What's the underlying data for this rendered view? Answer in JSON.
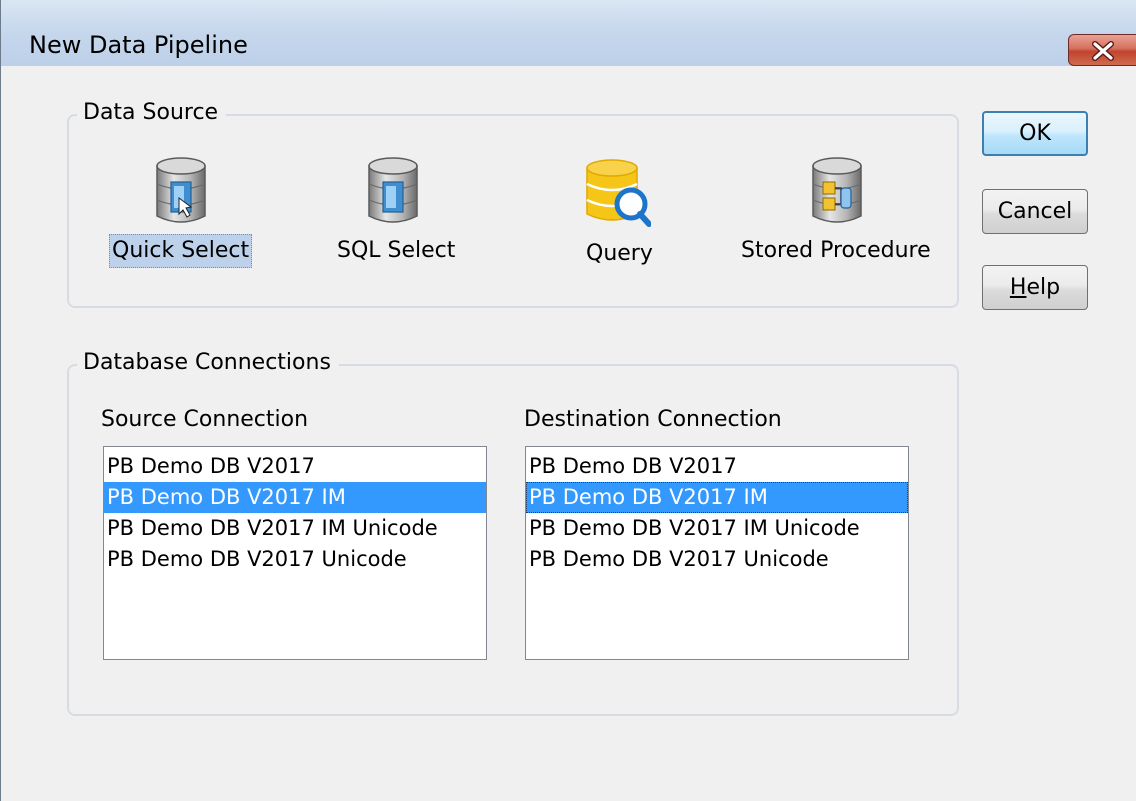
{
  "window": {
    "title": "New Data Pipeline",
    "close_icon": "close-icon"
  },
  "data_source": {
    "caption": "Data Source",
    "items": [
      {
        "label": "Quick Select",
        "icon": "database-quick-select-icon",
        "selected": true
      },
      {
        "label": "SQL Select",
        "icon": "database-sql-select-icon",
        "selected": false
      },
      {
        "label": "Query",
        "icon": "database-query-icon",
        "selected": false
      },
      {
        "label": "Stored Procedure",
        "icon": "database-stored-procedure-icon",
        "selected": false
      }
    ]
  },
  "buttons": {
    "ok": "OK",
    "cancel": "Cancel",
    "help_mnemonic": "H",
    "help_rest": "elp"
  },
  "connections": {
    "caption": "Database Connections",
    "source": {
      "label": "Source Connection",
      "items": [
        "PB Demo DB V2017",
        "PB Demo DB V2017 IM",
        "PB Demo DB V2017 IM Unicode",
        "PB Demo DB V2017 Unicode"
      ],
      "selected_index": 1
    },
    "destination": {
      "label": "Destination Connection",
      "items": [
        "PB Demo DB V2017",
        "PB Demo DB V2017 IM",
        "PB Demo DB V2017 IM Unicode",
        "PB Demo DB V2017 Unicode"
      ],
      "selected_index": 1
    }
  },
  "colors": {
    "selection": "#3399ff",
    "query_icon": "#f5c518",
    "default_button_border": "#3c7fb1"
  }
}
